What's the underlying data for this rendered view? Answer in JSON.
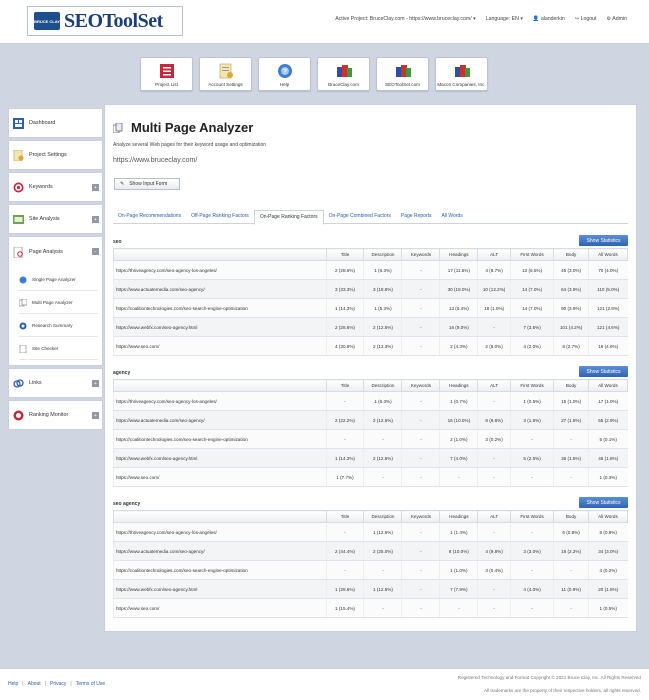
{
  "header": {
    "logo_text": "SEOToolSet",
    "logo_badge": "BRUCE CLAY",
    "active_project": "Active Project: BruceClay.com - https://www.bruceclay.com/",
    "language": "Language: EN",
    "user": "alanderkin",
    "logout": "Logout",
    "admin": "Admin"
  },
  "tiles": [
    {
      "label": "Project List",
      "icon": "list-icon"
    },
    {
      "label": "Account Settings",
      "icon": "account-settings-icon"
    },
    {
      "label": "Help",
      "icon": "help-icon"
    },
    {
      "label": "BruceClay.com",
      "icon": "cubes-icon"
    },
    {
      "label": "SEOToolSet.com",
      "icon": "cubes-icon"
    },
    {
      "label": "Macon Companies, Inc.",
      "icon": "cubes-icon"
    }
  ],
  "sidebar": {
    "dashboard": "Dashboard",
    "project_settings": "Project Settings",
    "keywords": "Keywords",
    "site_analysis": "Site Analysis",
    "page_analysis": "Page Analysis",
    "sub_items": [
      "Single Page Analyzer",
      "Multi Page Analyzer",
      "Research Summary",
      "Site Checker"
    ],
    "links": "Links",
    "ranking_monitor": "Ranking Monitor"
  },
  "main": {
    "title": "Multi Page Analyzer",
    "subtitle": "Analyze several Web pages for their keyword usage and optimization",
    "site_url": "https://www.bruceclay.com/",
    "show_form": "Show Input Form",
    "tabs": [
      "On-Page Recommendations",
      "Off-Page Ranking Factors",
      "On-Page Ranking Factors",
      "On-Page Combined Factors",
      "Page Reports",
      "All Words"
    ],
    "stats_button": "Show Statistics",
    "columns": [
      "",
      "Title",
      "Description",
      "Keywords",
      "Headings",
      "ALT",
      "First Words",
      "Body",
      "All Words"
    ]
  },
  "sections": [
    {
      "keyword": "seo",
      "rows": [
        [
          "https://thriveagency.com/seo-agency-los-angeles/",
          "2 (28.6%)",
          "1 (6.3%)",
          "-",
          "17 (11.6%)",
          "4 (8.7%)",
          "13 (6.5%)",
          "45 (3.0%)",
          "70 (4.0%)"
        ],
        [
          "https://www.actuatemedia.com/seo-agency/",
          "3 (33.3%)",
          "3 (18.8%)",
          "-",
          "30 (18.0%)",
          "10 (12.2%)",
          "14 (7.0%)",
          "64 (3.9%)",
          "110 (5.0%)"
        ],
        [
          "https://coalitiontechnologies.com/seo-search-engine-optimization",
          "1 (14.3%)",
          "1 (5.3%)",
          "-",
          "13 (6.4%)",
          "16 (1.0%)",
          "14 (7.0%)",
          "90 (3.9%)",
          "121 (2.9%)"
        ],
        [
          "https://www.webfx.com/seo-agency.html",
          "2 (28.6%)",
          "2 (12.5%)",
          "-",
          "16 (9.0%)",
          "-",
          "7 (3.5%)",
          "101 (4.2%)",
          "121 (4.6%)"
        ],
        [
          "https://www.seo.com/",
          "4 (30.8%)",
          "2 (13.3%)",
          "-",
          "2 (4.3%)",
          "2 (8.0%)",
          "4 (2.0%)",
          "8 (2.7%)",
          "18 (4.6%)"
        ]
      ]
    },
    {
      "keyword": "agency",
      "rows": [
        [
          "https://thriveagency.com/seo-agency-los-angeles/",
          "-",
          "1 (6.3%)",
          "-",
          "1 (0.7%)",
          "-",
          "1 (0.5%)",
          "15 (1.0%)",
          "17 (1.0%)"
        ],
        [
          "https://www.actuatemedia.com/seo-agency/",
          "2 (22.2%)",
          "2 (12.5%)",
          "-",
          "16 (10.0%)",
          "8 (9.8%)",
          "3 (1.5%)",
          "27 (1.6%)",
          "55 (2.9%)"
        ],
        [
          "https://coalitiontechnologies.com/seo-search-engine-optimization",
          "-",
          "-",
          "-",
          "2 (1.0%)",
          "3 (0.2%)",
          "-",
          "-",
          "5 (0.1%)"
        ],
        [
          "https://www.webfx.com/seo-agency.html",
          "1 (14.3%)",
          "2 (12.5%)",
          "-",
          "7 (4.0%)",
          "-",
          "5 (2.5%)",
          "36 (1.5%)",
          "46 (1.8%)"
        ],
        [
          "https://www.seo.com/",
          "1 (7.7%)",
          "-",
          "-",
          "-",
          "-",
          "-",
          "-",
          "1 (0.3%)"
        ]
      ]
    },
    {
      "keyword": "seo agency",
      "rows": [
        [
          "https://thriveagency.com/seo-agency-los-angeles/",
          "-",
          "1 (12.5%)",
          "-",
          "1 (1.4%)",
          "-",
          "-",
          "6 (0.8%)",
          "8 (0.9%)"
        ],
        [
          "https://www.actuatemedia.com/seo-agency/",
          "2 (44.4%)",
          "2 (25.0%)",
          "-",
          "8 (10.0%)",
          "4 (9.8%)",
          "3 (3.0%)",
          "18 (2.2%)",
          "34 (3.0%)"
        ],
        [
          "https://coalitiontechnologies.com/seo-search-engine-optimization",
          "-",
          "-",
          "-",
          "1 (1.0%)",
          "3 (0.4%)",
          "-",
          "-",
          "4 (0.2%)"
        ],
        [
          "https://www.webfx.com/seo-agency.html",
          "1 (28.6%)",
          "1 (12.5%)",
          "-",
          "7 (7.9%)",
          "-",
          "4 (4.0%)",
          "11 (0.9%)",
          "20 (1.5%)"
        ],
        [
          "https://www.seo.com/",
          "1 (15.4%)",
          "-",
          "-",
          "-",
          "-",
          "-",
          "-",
          "1 (0.5%)"
        ]
      ]
    }
  ],
  "footer": {
    "links": [
      "Help",
      "About",
      "Privacy",
      "Terms of Use"
    ],
    "legal1": "Registered Technology and Format Copyright © 2021 Bruce Clay, Inc. All Rights Reserved",
    "legal2": "All trademarks are the property of their respective holders, all rights reserved."
  }
}
